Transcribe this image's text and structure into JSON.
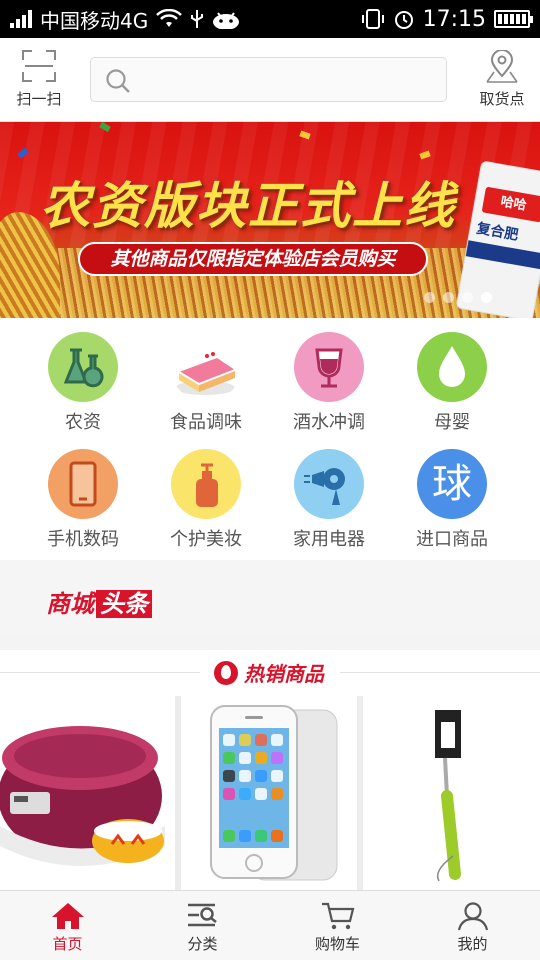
{
  "status_bar": {
    "carrier": "中国移动4G",
    "time": "17:15"
  },
  "header": {
    "scan_label": "扫一扫",
    "search_placeholder": "",
    "pickup_label": "取货点"
  },
  "banner": {
    "title": "农资版块正式上线",
    "subtitle": "其他商品仅限指定体验店会员购买",
    "bag_brand": "哈哈",
    "bag_title": "复合肥",
    "slide_count": 4,
    "active_slide": 4
  },
  "categories": [
    {
      "label": "农资",
      "icon": "lab-flasks-icon",
      "color": "#a6d96a"
    },
    {
      "label": "食品调味",
      "icon": "cake-icon",
      "color": "#fbe4e8"
    },
    {
      "label": "酒水冲调",
      "icon": "wine-glass-icon",
      "color": "#f19ac2"
    },
    {
      "label": "母婴",
      "icon": "water-drop-icon",
      "color": "#8cd04a"
    },
    {
      "label": "手机数码",
      "icon": "mobile-phone-icon",
      "color": "#f2a063"
    },
    {
      "label": "个护美妆",
      "icon": "lotion-bottle-icon",
      "color": "#fbe46a"
    },
    {
      "label": "家用电器",
      "icon": "hair-dryer-icon",
      "color": "#8fcff2"
    },
    {
      "label": "进口商品",
      "icon": "globe-char-icon",
      "color": "#4a90e8",
      "glyph": "球"
    }
  ],
  "headline": {
    "part_a": "商城",
    "part_b": "头条"
  },
  "hot": {
    "title": "热销商品",
    "products": [
      {
        "name": "rice-cooker"
      },
      {
        "name": "smartphone"
      },
      {
        "name": "selfie-stick"
      }
    ]
  },
  "tabbar": {
    "tabs": [
      {
        "label": "首页",
        "icon": "home-icon",
        "active": true
      },
      {
        "label": "分类",
        "icon": "category-search-icon",
        "active": false
      },
      {
        "label": "购物车",
        "icon": "cart-icon",
        "active": false
      },
      {
        "label": "我的",
        "icon": "user-icon",
        "active": false
      }
    ]
  },
  "colors": {
    "brand_red": "#d8142c",
    "banner_red": "#e6231a"
  }
}
